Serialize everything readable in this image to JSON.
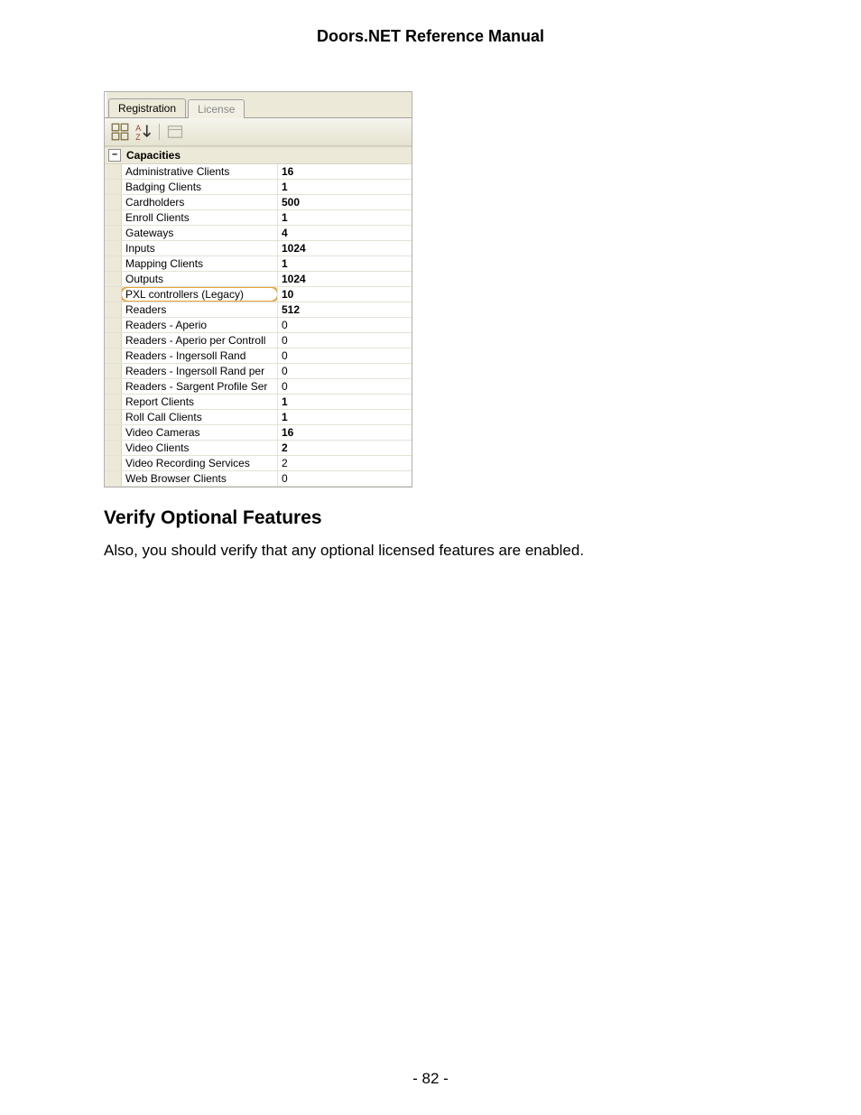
{
  "doc_title": "Doors.NET Reference Manual",
  "tabs": {
    "registration": "Registration",
    "license": "License"
  },
  "grid": {
    "category": "Capacities",
    "expander": "−",
    "rows": [
      {
        "label": "Administrative Clients",
        "value": "16",
        "bold": true,
        "highlight": false
      },
      {
        "label": "Badging Clients",
        "value": "1",
        "bold": true,
        "highlight": false
      },
      {
        "label": "Cardholders",
        "value": "500",
        "bold": true,
        "highlight": false
      },
      {
        "label": "Enroll Clients",
        "value": "1",
        "bold": true,
        "highlight": false
      },
      {
        "label": "Gateways",
        "value": "4",
        "bold": true,
        "highlight": false
      },
      {
        "label": "Inputs",
        "value": "1024",
        "bold": true,
        "highlight": false
      },
      {
        "label": "Mapping Clients",
        "value": "1",
        "bold": true,
        "highlight": false
      },
      {
        "label": "Outputs",
        "value": "1024",
        "bold": true,
        "highlight": false
      },
      {
        "label": "PXL controllers (Legacy)",
        "value": "10",
        "bold": true,
        "highlight": true
      },
      {
        "label": "Readers",
        "value": "512",
        "bold": true,
        "highlight": false
      },
      {
        "label": "Readers - Aperio",
        "value": "0",
        "bold": false,
        "highlight": false
      },
      {
        "label": "Readers - Aperio per Controll",
        "value": "0",
        "bold": false,
        "highlight": false
      },
      {
        "label": "Readers - Ingersoll Rand",
        "value": "0",
        "bold": false,
        "highlight": false
      },
      {
        "label": "Readers - Ingersoll Rand per",
        "value": "0",
        "bold": false,
        "highlight": false
      },
      {
        "label": "Readers - Sargent Profile Ser",
        "value": "0",
        "bold": false,
        "highlight": false
      },
      {
        "label": "Report Clients",
        "value": "1",
        "bold": true,
        "highlight": false
      },
      {
        "label": "Roll Call Clients",
        "value": "1",
        "bold": true,
        "highlight": false
      },
      {
        "label": "Video Cameras",
        "value": "16",
        "bold": true,
        "highlight": false
      },
      {
        "label": "Video Clients",
        "value": "2",
        "bold": true,
        "highlight": false
      },
      {
        "label": "Video Recording Services",
        "value": "2",
        "bold": false,
        "highlight": false
      },
      {
        "label": "Web Browser Clients",
        "value": "0",
        "bold": false,
        "highlight": false
      }
    ]
  },
  "section_heading": "Verify Optional Features",
  "body_text": "Also, you should verify that any optional licensed features are enabled.",
  "page_number": "- 82 -"
}
